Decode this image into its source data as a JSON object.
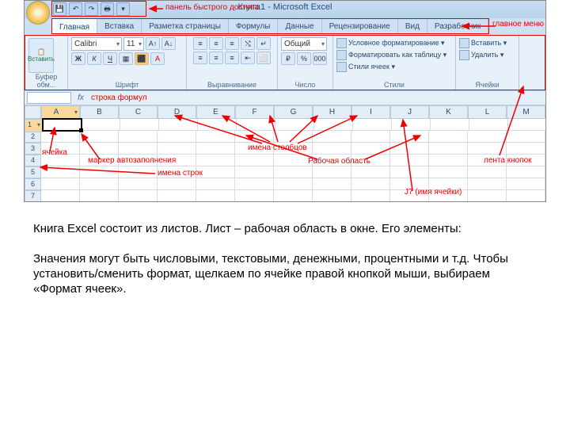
{
  "window": {
    "title": "Книга1 - Microsoft Excel"
  },
  "qat_annotation": "панель быстрого доступа",
  "main_menu_label": "главное меню",
  "tabs": [
    "Главная",
    "Вставка",
    "Разметка страницы",
    "Формулы",
    "Данные",
    "Рецензирование",
    "Вид",
    "Разработчик"
  ],
  "ribbon": {
    "clipboard": {
      "paste": "Вставить",
      "label": "Буфер обм..."
    },
    "font": {
      "name": "Calibri",
      "size": "11",
      "label": "Шрифт"
    },
    "align": {
      "label": "Выравнивание"
    },
    "number": {
      "format": "Общий",
      "label": "Число"
    },
    "styles": {
      "cond": "Условное форматирование ▾",
      "table": "Форматировать как таблицу ▾",
      "cell": "Стили ячеек ▾",
      "label": "Стили"
    },
    "cells": {
      "insert": "Вставить ▾",
      "delete": "Удалить ▾",
      "label": "Ячейки"
    }
  },
  "formula_bar_label": "строка формул",
  "columns": [
    "A",
    "B",
    "C",
    "D",
    "E",
    "F",
    "G",
    "H",
    "I",
    "J",
    "K",
    "L",
    "M"
  ],
  "rows": [
    "1",
    "2",
    "3",
    "4",
    "5",
    "6",
    "7"
  ],
  "annotations": {
    "cell": "ячейка",
    "autofill": "маркер автозаполнения",
    "row_names": "имена строк",
    "col_names": "имена столбцов",
    "work_area": "Рабочая область",
    "cell_name": "J7 (имя ячейки)",
    "ribbon_buttons": "лента кнопок"
  },
  "paragraph1": "Книга Excel состоит из листов. Лист – рабочая область в окне. Его элементы:",
  "paragraph2": "Значения могут быть числовыми, текстовыми, денежными, процентными и т.д. Чтобы установить/сменить формат, щелкаем по ячейке правой кнопкой мыши, выбираем «Формат ячеек»."
}
